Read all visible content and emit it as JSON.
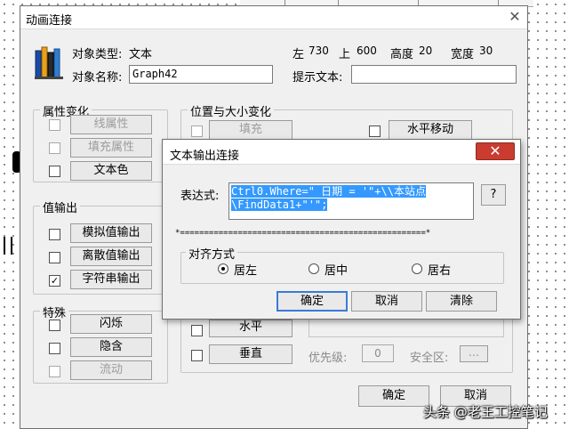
{
  "main_dialog": {
    "title": "动画连接",
    "object_type_label": "对象类型:",
    "object_type_value": "文本",
    "left_label": "左",
    "left_value": "730",
    "top_label": "上",
    "top_value": "600",
    "height_label": "高度",
    "height_value": "20",
    "width_label": "宽度",
    "width_value": "30",
    "object_name_label": "对象名称:",
    "object_name_value": "Graph42",
    "hint_label": "提示文本:",
    "hint_value": "",
    "attr_group": {
      "title": "属性变化",
      "line_attr": "线属性",
      "fill_attr": "填充属性",
      "text_color": "文本色"
    },
    "pos_group": {
      "title": "位置与大小变化",
      "fill": "填充",
      "h_move": "水平移动",
      "horizontal": "水平",
      "vertical": "垂直"
    },
    "value_output_group": {
      "title": "值输出",
      "analog": "模拟值输出",
      "discrete": "离散值输出",
      "string": "字符串输出",
      "string_checked": "✓"
    },
    "special_group": {
      "title": "特殊",
      "flash": "闪烁",
      "hide": "隐含",
      "flow": "流动"
    },
    "priority_label": "优先级:",
    "priority_value": "0",
    "security_label": "安全区:",
    "security_btn": "...",
    "ok": "确定",
    "cancel": "取消"
  },
  "text_dialog": {
    "title": "文本输出连接",
    "expr_label": "表达式:",
    "expr_line1": "Ctrl0.Where=\" 日期 = '\"+\\\\本站点",
    "expr_line2": "\\FindData1+\"'\";",
    "browse_btn": "?",
    "separator": "*===================================================*",
    "align_title": "对齐方式",
    "align_left": "居左",
    "align_center": "居中",
    "align_right": "居右",
    "ok": "确定",
    "cancel": "取消",
    "clear": "清除"
  },
  "watermark": "头条 @老王工控笔记",
  "icons": {
    "close": "✕",
    "books": "books-icon"
  },
  "colors": {
    "close_red": "#c93c2f",
    "selection_blue": "#3399ff"
  }
}
